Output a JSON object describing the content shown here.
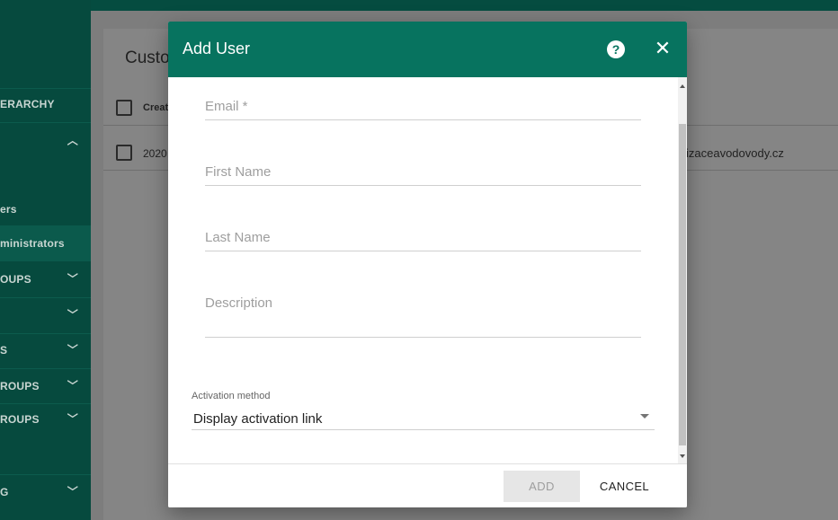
{
  "background": {
    "card_title": "Custo",
    "table": {
      "header_text": "Creat",
      "row_text": "2020",
      "row_email": "izaceavodovody.cz"
    },
    "sidebar": {
      "items": [
        {
          "label": "ERARCHY"
        },
        {
          "label": ""
        },
        {
          "label": "ers"
        },
        {
          "label": "ministrators"
        },
        {
          "label": "OUPS"
        },
        {
          "label": ""
        },
        {
          "label": "S"
        },
        {
          "label": "ROUPS"
        },
        {
          "label": "ROUPS"
        },
        {
          "label": "G"
        }
      ]
    }
  },
  "dialog": {
    "title": "Add User",
    "help_glyph": "?",
    "close_glyph": "✕",
    "fields": {
      "email_placeholder": "Email *",
      "first_name_placeholder": "First Name",
      "last_name_placeholder": "Last Name",
      "description_placeholder": "Description"
    },
    "activation": {
      "label": "Activation method",
      "value": "Display activation link"
    },
    "buttons": {
      "add": "ADD",
      "cancel": "CANCEL"
    }
  },
  "colors": {
    "dialog_header": "#07735f",
    "sidebar": "#064a3e"
  }
}
